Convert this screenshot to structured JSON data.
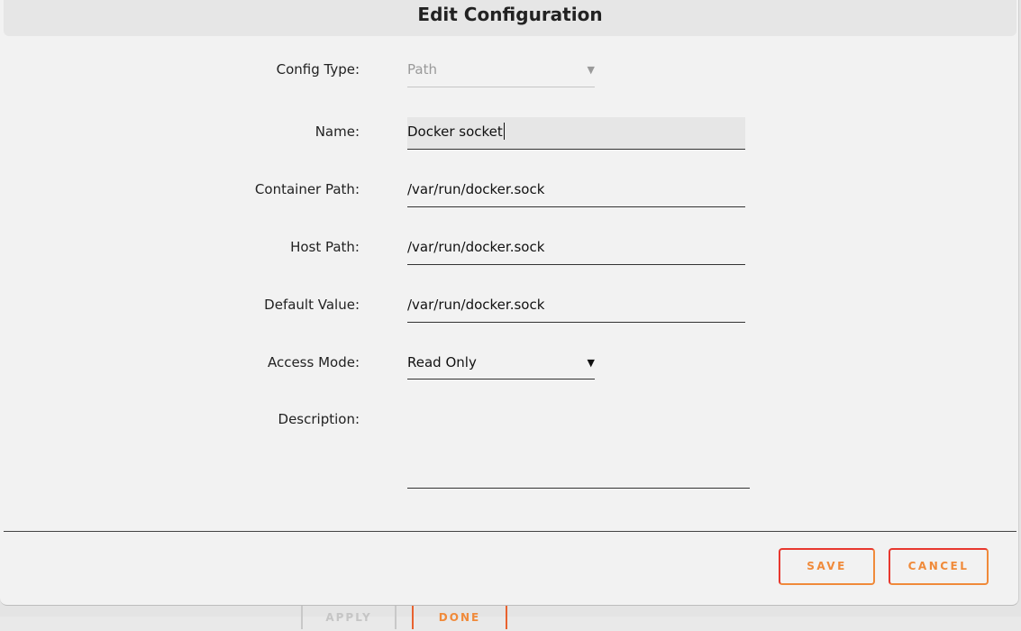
{
  "dialog": {
    "title": "Edit Configuration"
  },
  "form": {
    "config_type": {
      "label": "Config Type:",
      "value": "Path"
    },
    "name": {
      "label": "Name:",
      "value": "Docker socket"
    },
    "container_path": {
      "label": "Container Path:",
      "value": "/var/run/docker.sock"
    },
    "host_path": {
      "label": "Host Path:",
      "value": "/var/run/docker.sock"
    },
    "default_value": {
      "label": "Default Value:",
      "value": "/var/run/docker.sock"
    },
    "access_mode": {
      "label": "Access Mode:",
      "value": "Read Only"
    },
    "description": {
      "label": "Description:",
      "value": ""
    }
  },
  "buttons": {
    "save": "SAVE",
    "cancel": "CANCEL"
  },
  "background": {
    "apply": "APPLY",
    "done": "DONE"
  },
  "icons": {
    "dropdown": "▼"
  },
  "colors": {
    "accent": "#f08a3a",
    "accent_border": "#e8382f"
  }
}
